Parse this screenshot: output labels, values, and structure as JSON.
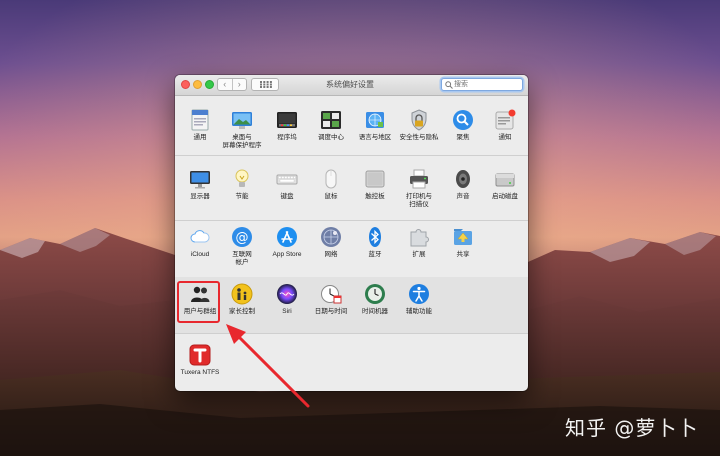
{
  "window": {
    "title": "系统偏好设置",
    "nav_back": "‹",
    "nav_forward": "›",
    "search_placeholder": "搜索"
  },
  "sections": [
    {
      "items": [
        {
          "label": "通用",
          "icon": "general-icon"
        },
        {
          "label": "桌面与\n屏幕保护程序",
          "icon": "desktop-screensaver-icon"
        },
        {
          "label": "程序坞",
          "icon": "dock-icon"
        },
        {
          "label": "调度中心",
          "icon": "mission-control-icon"
        },
        {
          "label": "语言与地区",
          "icon": "language-region-icon"
        },
        {
          "label": "安全性与隐私",
          "icon": "security-privacy-icon"
        },
        {
          "label": "聚焦",
          "icon": "spotlight-icon"
        },
        {
          "label": "通知",
          "icon": "notifications-icon"
        }
      ]
    },
    {
      "items": [
        {
          "label": "显示器",
          "icon": "displays-icon"
        },
        {
          "label": "节能",
          "icon": "energy-saver-icon"
        },
        {
          "label": "键盘",
          "icon": "keyboard-icon"
        },
        {
          "label": "鼠标",
          "icon": "mouse-icon"
        },
        {
          "label": "触控板",
          "icon": "trackpad-icon"
        },
        {
          "label": "打印机与\n扫描仪",
          "icon": "printers-scanners-icon"
        },
        {
          "label": "声音",
          "icon": "sound-icon"
        },
        {
          "label": "启动磁盘",
          "icon": "startup-disk-icon"
        }
      ]
    },
    {
      "items": [
        {
          "label": "iCloud",
          "icon": "icloud-icon"
        },
        {
          "label": "互联网\n帐户",
          "icon": "internet-accounts-icon"
        },
        {
          "label": "App Store",
          "icon": "app-store-icon"
        },
        {
          "label": "网络",
          "icon": "network-icon"
        },
        {
          "label": "蓝牙",
          "icon": "bluetooth-icon"
        },
        {
          "label": "扩展",
          "icon": "extensions-icon"
        },
        {
          "label": "共享",
          "icon": "sharing-icon"
        }
      ]
    },
    {
      "items": [
        {
          "label": "用户与群组",
          "icon": "users-groups-icon"
        },
        {
          "label": "家长控制",
          "icon": "parental-controls-icon"
        },
        {
          "label": "Siri",
          "icon": "siri-icon"
        },
        {
          "label": "日期与时间",
          "icon": "date-time-icon"
        },
        {
          "label": "时间机器",
          "icon": "time-machine-icon"
        },
        {
          "label": "辅助功能",
          "icon": "accessibility-icon"
        }
      ]
    },
    {
      "items": [
        {
          "label": "Tuxera NTFS",
          "icon": "tuxera-ntfs-icon"
        }
      ]
    }
  ],
  "colors": {
    "highlight": "#e8282e",
    "arrow": "#e8282e"
  },
  "watermark": "知乎 @萝卜卜"
}
